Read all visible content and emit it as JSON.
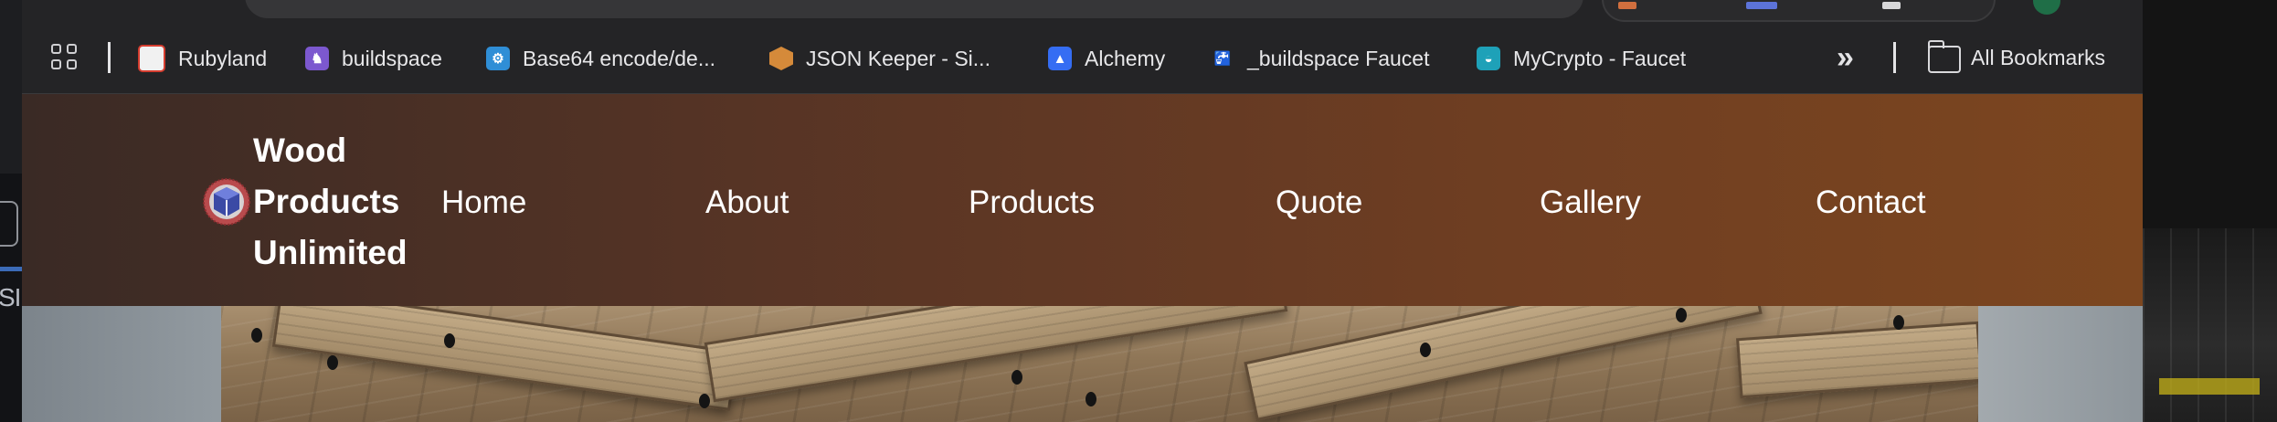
{
  "bookmarks": {
    "items": [
      {
        "label": "Rubyland",
        "icon": "rubyland-favicon"
      },
      {
        "label": "buildspace",
        "icon": "buildspace-favicon"
      },
      {
        "label": "Base64 encode/de...",
        "icon": "base64-favicon"
      },
      {
        "label": "JSON Keeper - Si...",
        "icon": "json-keeper-favicon"
      },
      {
        "label": "Alchemy",
        "icon": "alchemy-favicon"
      },
      {
        "label": "_buildspace Faucet",
        "icon": "faucet-favicon"
      },
      {
        "label": "MyCrypto - Faucet",
        "icon": "mycrypto-favicon"
      }
    ],
    "overflow_icon": "chevron-double-right-icon",
    "all_bookmarks_label": "All Bookmarks"
  },
  "site": {
    "brand_lines": [
      "Wood",
      "Products",
      "Unlimited"
    ],
    "nav": [
      "Home",
      "About",
      "Products",
      "Quote",
      "Gallery",
      "Contact"
    ],
    "header_gradient": [
      "#3a2a25",
      "#7c461f"
    ]
  }
}
